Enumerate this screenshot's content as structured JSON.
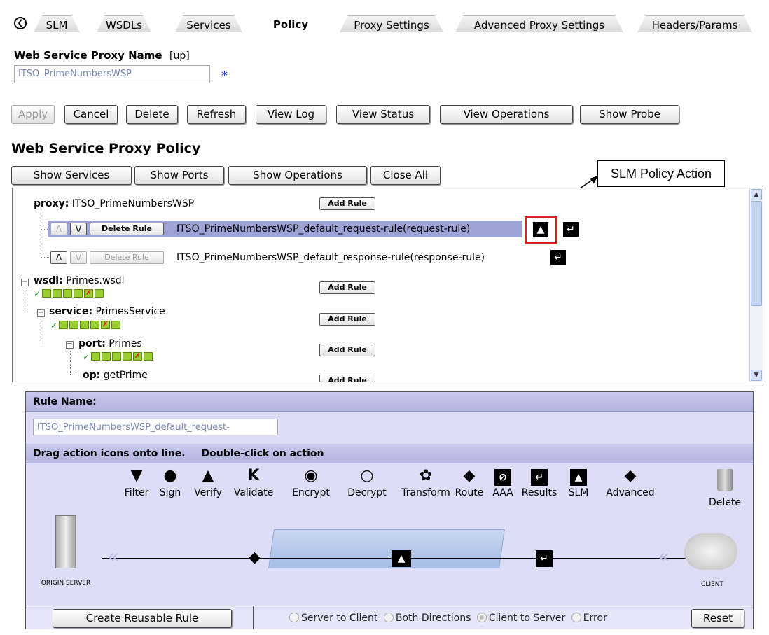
{
  "tabs": [
    "SLM",
    "WSDLs",
    "Services",
    "Policy",
    "Proxy Settings",
    "Advanced Proxy Settings",
    "Headers/Params"
  ],
  "active_tab": "Policy",
  "proxy_name": {
    "label": "Web Service Proxy Name",
    "status": "[up]",
    "value": "ITSO_PrimeNumbersWSP",
    "required_marker": "*"
  },
  "toolbar": {
    "apply": "Apply",
    "cancel": "Cancel",
    "delete": "Delete",
    "refresh": "Refresh",
    "view_log": "View Log",
    "view_status": "View Status",
    "view_operations": "View Operations",
    "show_probe": "Show Probe"
  },
  "policy": {
    "heading": "Web Service Proxy Policy",
    "show_services": "Show Services",
    "show_ports": "Show Ports",
    "show_operations": "Show Operations",
    "close_all": "Close All"
  },
  "callout": "SLM Policy Action",
  "tree": {
    "proxy_key": "proxy:",
    "proxy_name": "ITSO_PrimeNumbersWSP",
    "add_rule": "Add Rule",
    "delete_rule": "Delete Rule",
    "up_arrow": "/\\",
    "down_arrow": "\\/",
    "request_rule": "ITSO_PrimeNumbersWSP_default_request-rule(request-rule)",
    "response_rule": "ITSO_PrimeNumbersWSP_default_response-rule(response-rule)",
    "wsdl_key": "wsdl:",
    "wsdl_name": "Primes.wsdl",
    "service_key": "service:",
    "service_name": "PrimesService",
    "port_key": "port:",
    "port_name": "Primes",
    "op_key": "op:",
    "op_name": "getPrime"
  },
  "rule_editor": {
    "rule_name_label": "Rule Name:",
    "rule_name_value": "ITSO_PrimeNumbersWSP_default_request-",
    "instructions_1": "Drag action icons onto line.",
    "instructions_2": "Double-click on action",
    "palette": [
      "Filter",
      "Sign",
      "Verify",
      "Validate",
      "Encrypt",
      "Decrypt",
      "Transform",
      "Route",
      "AAA",
      "Results",
      "SLM",
      "Advanced"
    ],
    "delete": "Delete",
    "origin_server": "ORIGIN SERVER",
    "client": "CLIENT",
    "create_reusable_rule": "Create Reusable Rule",
    "directions": [
      "Server to Client",
      "Both Directions",
      "Client to Server",
      "Error"
    ],
    "selected_direction": "Client to Server",
    "reset": "Reset"
  }
}
